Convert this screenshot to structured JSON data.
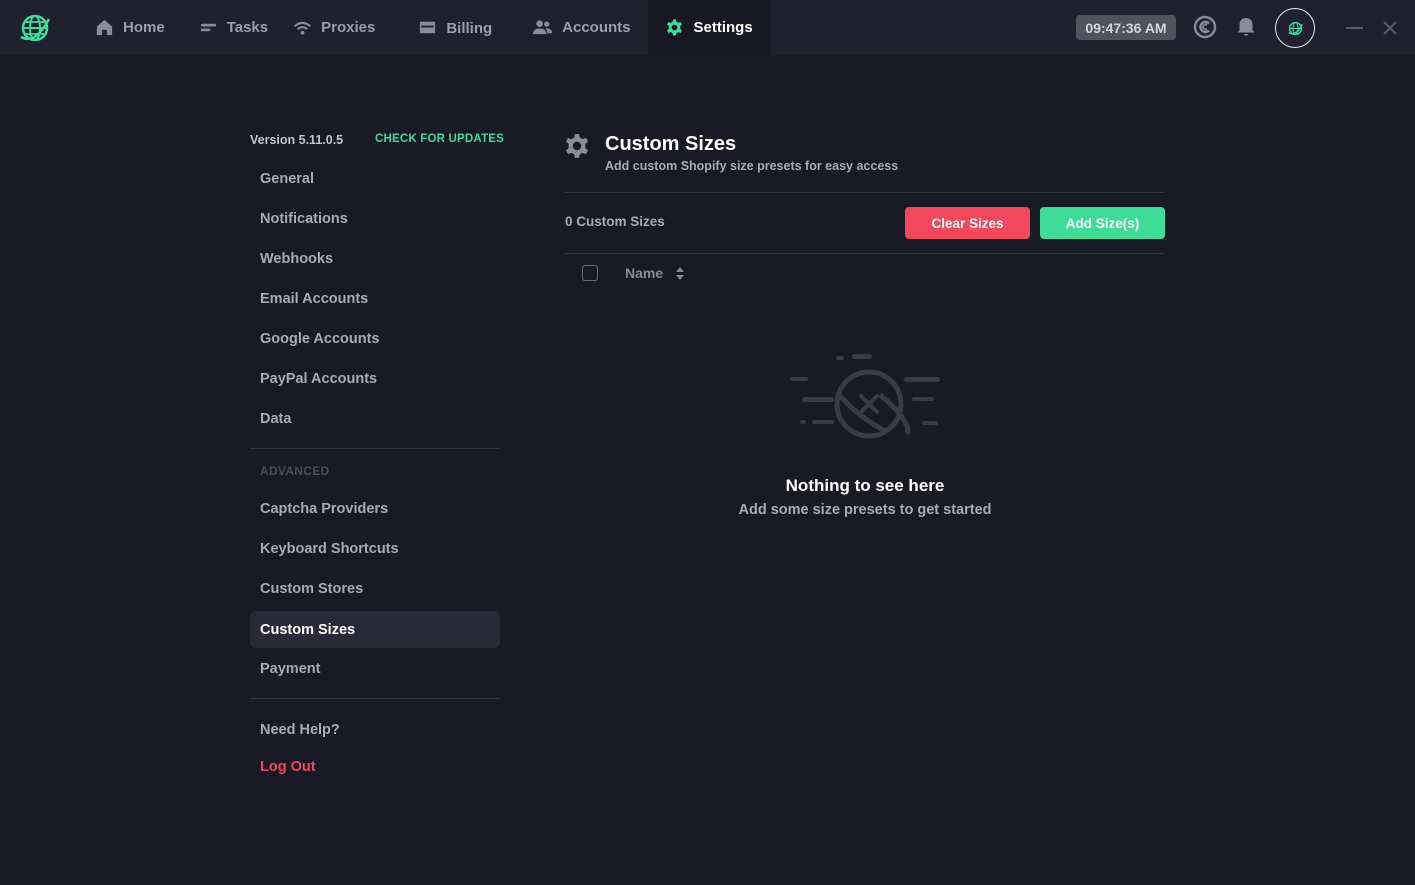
{
  "nav": [
    {
      "label": "Home",
      "icon": "home-icon"
    },
    {
      "label": "Tasks",
      "icon": "tasks-icon"
    },
    {
      "label": "Proxies",
      "icon": "wifi-icon"
    },
    {
      "label": "Billing",
      "icon": "billing-card-icon"
    },
    {
      "label": "Accounts",
      "icon": "accounts-users-icon"
    },
    {
      "label": "Settings",
      "icon": "gear-icon",
      "active": true
    }
  ],
  "clock": "09:47:36 AM",
  "sidebar": {
    "version": "Version 5.11.0.5",
    "check_updates": "CHECK FOR UPDATES",
    "items": [
      "General",
      "Notifications",
      "Webhooks",
      "Email Accounts",
      "Google Accounts",
      "PayPal Accounts",
      "Data"
    ],
    "advanced_label": "ADVANCED",
    "advanced_items": [
      "Captcha Providers",
      "Keyboard Shortcuts",
      "Custom Stores",
      "Custom Sizes",
      "Payment"
    ],
    "active_item": "Custom Sizes",
    "help": "Need Help?",
    "logout": "Log Out"
  },
  "main": {
    "title": "Custom Sizes",
    "subtitle": "Add custom Shopify size presets for easy access",
    "count_label": "0 Custom Sizes",
    "clear_button": "Clear Sizes",
    "add_button": "Add Size(s)",
    "column_name": "Name",
    "empty_title": "Nothing to see here",
    "empty_subtitle": "Add some size presets to get started"
  },
  "colors": {
    "accent": "#3ddc97",
    "danger": "#f2475d",
    "background": "#1a1a26",
    "topbar": "#20202e"
  }
}
